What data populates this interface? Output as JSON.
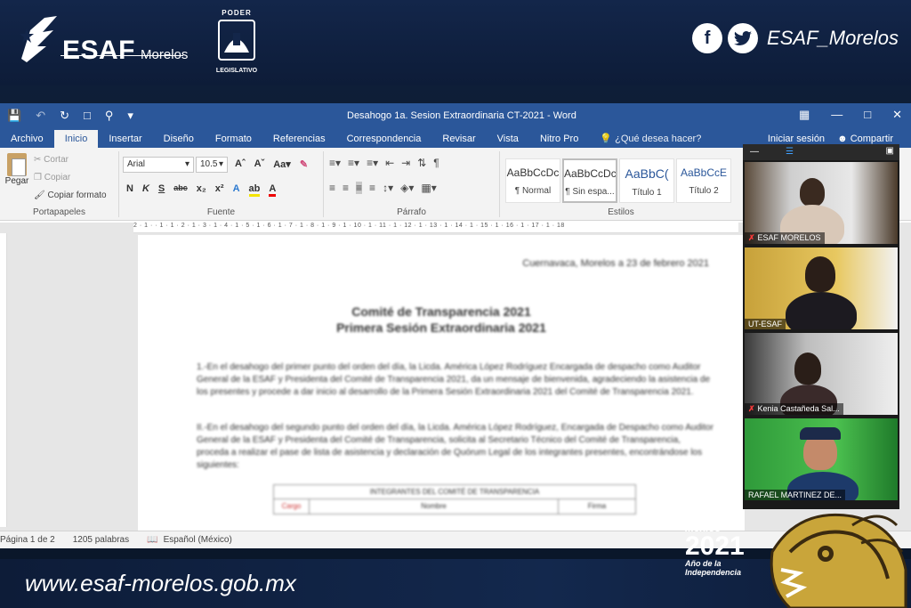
{
  "branding": {
    "esaf_name": "ESAF",
    "esaf_sub": "Morelos",
    "poder_top": "PODER",
    "poder_bottom": "LEGISLATIVO",
    "social_handle": "ESAF_Morelos",
    "facebook_glyph": "f",
    "url": "www.esaf-morelos.gob.mx",
    "mexico_line": "México",
    "year": "2021",
    "year_tag_line1": "Año de la",
    "year_tag_line2": "Independencia"
  },
  "word": {
    "doc_title": "Desahogo 1a. Sesion Extraordinaria CT-2021 - Word",
    "tabs": [
      "Archivo",
      "Inicio",
      "Insertar",
      "Diseño",
      "Formato",
      "Referencias",
      "Correspondencia",
      "Revisar",
      "Vista",
      "Nitro Pro"
    ],
    "active_tab": "Inicio",
    "tell_me": "¿Qué desea hacer?",
    "sign_in": "Iniciar sesión",
    "share": "Compartir",
    "clipboard": {
      "paste": "Pegar",
      "cut": "Cortar",
      "copy": "Copiar",
      "format_painter": "Copiar formato",
      "label": "Portapapeles"
    },
    "font": {
      "name": "Arial",
      "size": "10.5",
      "label": "Fuente",
      "bold": "N",
      "italic": "K",
      "underline": "S",
      "strike": "abc",
      "sub": "x₂",
      "sup": "x²"
    },
    "paragraph_label": "Párrafo",
    "styles": [
      {
        "sample": "AaBbCcDc",
        "name": "¶ Normal"
      },
      {
        "sample": "AaBbCcDc",
        "name": "¶ Sin espa..."
      },
      {
        "sample": "AaBbC(",
        "name": "Título 1"
      },
      {
        "sample": "AaBbCcE",
        "name": "Título 2"
      }
    ],
    "styles_label": "Estilos",
    "ruler_text": "2 · 1 · · 1 · 1 · 2 · 1 · 3 · 1 · 4 · 1 · 5 · 1 · 6 · 1 · 7 · 1 · 8 · 1 · 9 · 1 · 10 · 1 · 11 · 1 · 12 · 1 · 13 · 1 · 14 · 1 · 15 · 1 · 16 · 1 · 17 · 1 · 18",
    "document": {
      "date": "Cuernavaca, Morelos a 23 de febrero 2021",
      "heading1": "Comité de Transparencia 2021",
      "heading2": "Primera Sesión Extraordinaria 2021",
      "p1": "1.-En el desahogo del primer punto del orden del día, la Licda. América López Rodríguez Encargada de despacho como Auditor General de la ESAF y Presidenta del Comité de Transparencia 2021, da un mensaje de bienvenida, agradeciendo la asistencia de los presentes y procede a dar inicio al desarrollo de la Primera Sesión Extraordinaria 2021 del Comité de Transparencia 2021.",
      "p2": "II.-En el desahogo del segundo punto del orden del día, la Licda. América López Rodríguez, Encargada de Despacho como Auditor General de la ESAF y Presidenta del Comité de Transparencia, solicita al Secretario Técnico del Comité de Transparencia, proceda a realizar el pase de lista de asistencia y declaración de Quórum Legal de los integrantes presentes, encontrándose los siguientes:",
      "table_header": "INTEGRANTES DEL COMITÉ DE TRANSPARENCIA",
      "table_cols": [
        "Cargo",
        "Nombre",
        "Firma"
      ]
    },
    "status": {
      "page": "Página 1 de 2",
      "words": "1205 palabras",
      "language": "Español (México)"
    }
  },
  "participants": [
    {
      "name": "ESAF MORELOS",
      "muted": true
    },
    {
      "name": "UT-ESAF",
      "muted": false
    },
    {
      "name": "Kenia Castañeda Sal...",
      "muted": true
    },
    {
      "name": "RAFAEL MARTINEZ DE...",
      "muted": false
    }
  ],
  "colors": {
    "word_blue": "#2b579a",
    "band_navy": "#0d1c38"
  }
}
